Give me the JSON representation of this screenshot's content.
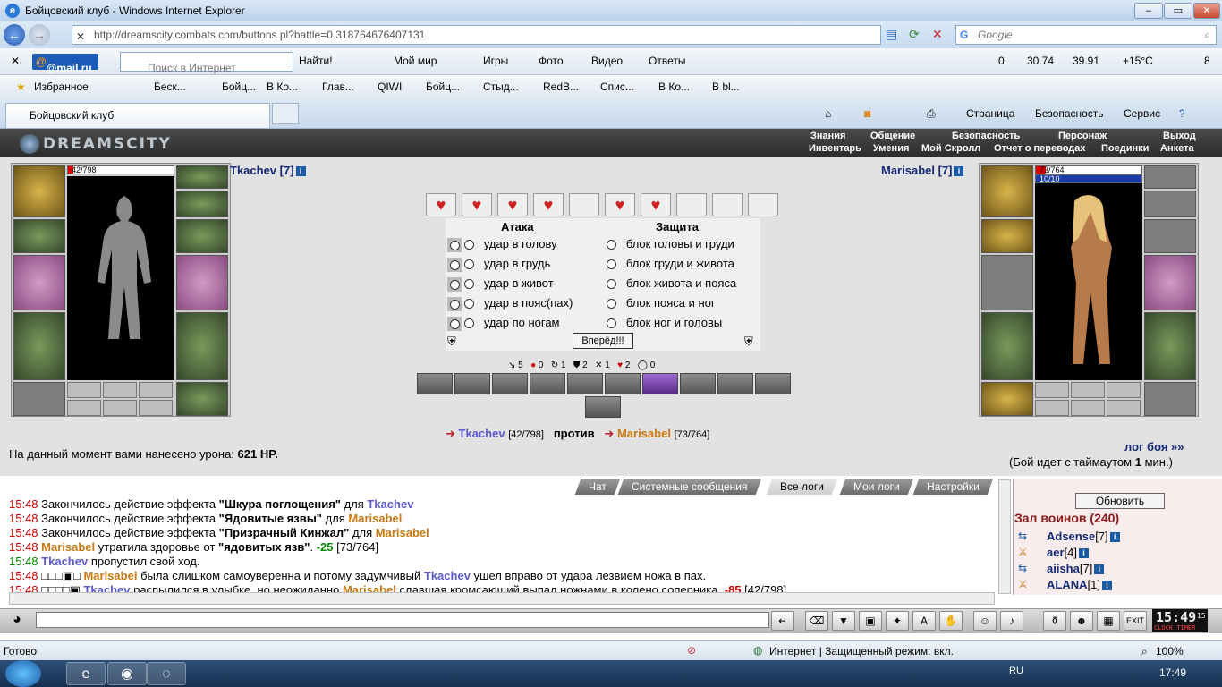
{
  "window": {
    "title": "Бойцовский клуб - Windows Internet Explorer",
    "url": "http://dreamscity.combats.com/buttons.pl?battle=0.318764676407131",
    "search_placeholder": "Google"
  },
  "toolbar": {
    "mail_logo": "@mail.ru",
    "search_placeholder": "Поиск в Интернет",
    "find_label": "Найти!",
    "moi_mir": "Мой мир",
    "games": "Игры",
    "photo": "Фото",
    "video": "Видео",
    "answers": "Ответы",
    "mail_count": "0",
    "usd": "30.74",
    "eur": "39.91",
    "weather": "+15°C",
    "traffic": "8"
  },
  "favorites": {
    "label": "Избранное",
    "items": [
      "Беск...",
      "Бойц...",
      "В Ко...",
      "Глав...",
      "QIWI",
      "Бойц...",
      "Стыд...",
      "RedB...",
      "Спис...",
      "В Ко...",
      "В bl..."
    ]
  },
  "tabs": {
    "active": "Бойцовский клуб",
    "page_menu": "Страница",
    "security_menu": "Безопасность",
    "service_menu": "Сервис"
  },
  "game": {
    "logo": "DREAMSCITY",
    "menu_top": [
      "Знания",
      "Общение",
      "Безопасность",
      "Персонаж",
      "Выход"
    ],
    "menu_bottom": [
      "Инвентарь",
      "Умения",
      "Мой Скролл",
      "Отчет о переводах",
      "Поединки",
      "Анкета"
    ],
    "player_left": {
      "name": "Tkachev [7]",
      "hp": "42/798",
      "hp_fraction": 0.053
    },
    "player_right": {
      "name": "Marisabel [7]",
      "hp": "73/764",
      "mana": "10/10",
      "hp_fraction": 0.096
    },
    "attack_header": "Атака",
    "defense_header": "Защита",
    "attacks": [
      "удар в голову",
      "удар в грудь",
      "удар в живот",
      "удар в пояс(пах)",
      "удар по ногам"
    ],
    "defenses": [
      "блок головы и груди",
      "блок груди и живота",
      "блок живота и пояса",
      "блок пояса и ног",
      "блок ног и головы"
    ],
    "go_button": "Вперёд!!!",
    "stats": [
      "5",
      "0",
      "1",
      "2",
      "1",
      "2",
      "0"
    ],
    "fighter_left": "Tkachev",
    "fighter_left_hp": "[42/798]",
    "versus": "против",
    "fighter_right": "Marisabel",
    "fighter_right_hp": "[73/764]",
    "damage_text": "На данный момент вами нанесено урона:",
    "damage_value": "621 HP.",
    "log_link": "лог боя »»",
    "timeout_text": "(Бой идет с таймаутом",
    "timeout_value": "1",
    "timeout_unit": "мин.)"
  },
  "log_tabs": [
    "Чат",
    "Системные сообщения",
    "Все логи",
    "Мои логи",
    "Настройки"
  ],
  "log": [
    {
      "time": "15:48",
      "a": "Закончилось действие эффекта ",
      "b": "\"Шкура поглощения\"",
      "c": " для ",
      "who": "Tkachev"
    },
    {
      "time": "15:48",
      "a": "Закончилось действие эффекта ",
      "b": "\"Ядовитые язвы\"",
      "c": " для ",
      "who": "Marisabel"
    },
    {
      "time": "15:48",
      "a": "Закончилось действие эффекта ",
      "b": "\"Призрачный Кинжал\"",
      "c": " для ",
      "who": "Marisabel"
    },
    {
      "time": "15:48",
      "who": "Marisabel",
      "a": " утратила здоровье от ",
      "b": "\"ядовитых язв\"",
      "c": ". ",
      "dmg": "-25",
      "rest": " [73/764]"
    },
    {
      "time": "15:48",
      "who": "Tkachev",
      "a": " пропустил свой ход."
    },
    {
      "time": "15:48",
      "who": "Marisabel",
      "a": " была слишком самоуверенна и потому задумчивый ",
      "who2": "Tkachev",
      "c": " ушел вправо от удара лезвием ножа в пах."
    },
    {
      "time": "15:48",
      "who": "Tkachev",
      "a": " распылился в улыбке, но неожиданно ",
      "who2": "Marisabel",
      "c": " сдавшая кромсающий выпад ножнами в колено соперника.",
      "dmg": "-85",
      "rest": " [42/798]"
    }
  ],
  "side": {
    "refresh": "Обновить",
    "hall_title": "Зал воинов (240)",
    "warriors": [
      {
        "name": "Adsense",
        "level": "[7]"
      },
      {
        "name": "aer",
        "level": "[4]"
      },
      {
        "name": "aiisha",
        "level": "[7]"
      },
      {
        "name": "ALANA",
        "level": "[1]"
      }
    ]
  },
  "clock": {
    "time": "15:49",
    "seconds": "15",
    "label": "CLOCK TIMER"
  },
  "status": {
    "ready": "Готово",
    "zone": "Интернет | Защищенный режим: вкл.",
    "zoom": "100%"
  },
  "taskbar": {
    "lang": "RU",
    "time": "17:49"
  }
}
